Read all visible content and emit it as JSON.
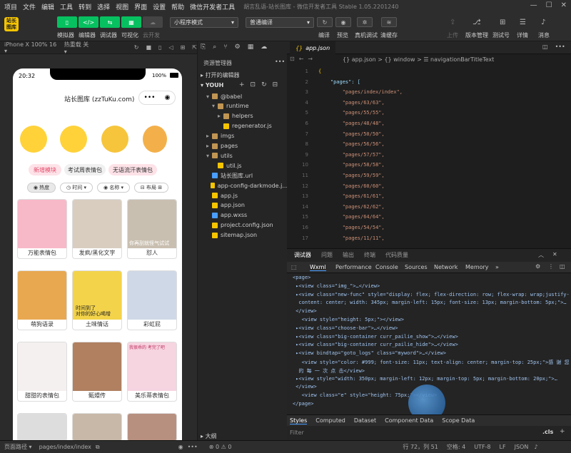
{
  "menubar": {
    "items": [
      "项目",
      "文件",
      "编辑",
      "工具",
      "转到",
      "选择",
      "视图",
      "界面",
      "设置",
      "帮助",
      "微信开发者工具"
    ],
    "title": "胡言乱语-站长图库 - 微信开发者工具 Stable 1.05.2201240"
  },
  "toolbar": {
    "logo": "站长图库",
    "simulator": "模拟器",
    "editor": "编辑器",
    "debugger": "调试器",
    "visual": "可视化",
    "cloud": "云开发",
    "mode_select": "小程序模式",
    "compile_select": "普通编译",
    "compile": "编译",
    "preview": "预览",
    "real_debug": "真机调试",
    "clear_cache": "清缓存",
    "upload": "上传",
    "version": "版本管理",
    "test": "测试号",
    "detail": "详情",
    "msg": "消息"
  },
  "simbar": {
    "device": "iPhone X 100% 16 ▾",
    "hot": "热重载 关 ▾"
  },
  "phone": {
    "time": "20:32",
    "battery": "100%",
    "title": "站长图库 (zzTuKu.com)",
    "tags": [
      "新增模块",
      "考试周表情包",
      "无语流汗表情包"
    ],
    "chips": [
      "热度",
      "时间",
      "名称",
      "布局"
    ],
    "cards": [
      {
        "cap": "万能表情包",
        "color": "#f7b8c8"
      },
      {
        "cap": "发疯/黑化文字",
        "color": "#d8cdbf"
      },
      {
        "cap": "怼人",
        "color": "#c9bfb0"
      },
      {
        "cap": "萌狗语录",
        "color": "#e8a850"
      },
      {
        "cap": "土味情话",
        "color": "#f3d34a"
      },
      {
        "cap": "彩虹屁",
        "color": "#cfd8e6"
      },
      {
        "cap": "甜甜的表情包",
        "color": "#f5f0f0"
      },
      {
        "cap": "甄嬛传",
        "color": "#b08060"
      },
      {
        "cap": "美乐蒂表情包",
        "color": "#f6d4e0"
      }
    ],
    "card_texts": [
      "你再刮就怪气试试",
      "时间到了\n对你的好心喝增",
      "我很乖的 考完了吧"
    ]
  },
  "explorer": {
    "title": "资源管理器",
    "open_editors": "打开的编辑器",
    "project": "YOUH",
    "files": [
      {
        "name": "@babel",
        "indent": 1,
        "type": "folder",
        "arrow": "▾"
      },
      {
        "name": "runtime",
        "indent": 2,
        "type": "folder",
        "arrow": "▾"
      },
      {
        "name": "helpers",
        "indent": 3,
        "type": "folder",
        "arrow": "▸"
      },
      {
        "name": "regenerator.js",
        "indent": 3,
        "type": "js",
        "arrow": ""
      },
      {
        "name": "imgs",
        "indent": 1,
        "type": "folder",
        "arrow": "▸"
      },
      {
        "name": "pages",
        "indent": 1,
        "type": "folder",
        "arrow": "▸"
      },
      {
        "name": "utils",
        "indent": 1,
        "type": "folder",
        "arrow": "▾"
      },
      {
        "name": "util.js",
        "indent": 2,
        "type": "js",
        "arrow": ""
      },
      {
        "name": "站长图库.url",
        "indent": 1,
        "type": "url",
        "arrow": ""
      },
      {
        "name": "app-config-darkmode.j...",
        "indent": 1,
        "type": "json",
        "arrow": ""
      },
      {
        "name": "app.js",
        "indent": 1,
        "type": "js",
        "arrow": ""
      },
      {
        "name": "app.json",
        "indent": 1,
        "type": "json",
        "arrow": ""
      },
      {
        "name": "app.wxss",
        "indent": 1,
        "type": "wxss",
        "arrow": ""
      },
      {
        "name": "project.config.json",
        "indent": 1,
        "type": "json",
        "arrow": ""
      },
      {
        "name": "sitemap.json",
        "indent": 1,
        "type": "json",
        "arrow": ""
      }
    ],
    "outline": "大纲"
  },
  "editor": {
    "tab": "app.json",
    "breadcrumb": "{} app.json > {} window > ☰ navigationBarTitleText",
    "lines": [
      "{",
      "    \"pages\": [",
      "        \"pages/index/index\",",
      "        \"pages/63/63\",",
      "        \"pages/55/55\",",
      "        \"pages/48/48\",",
      "        \"pages/50/50\",",
      "        \"pages/56/56\",",
      "        \"pages/57/57\",",
      "        \"pages/58/58\",",
      "        \"pages/59/59\",",
      "        \"pages/60/60\",",
      "        \"pages/61/61\",",
      "        \"pages/62/62\",",
      "        \"pages/64/64\",",
      "        \"pages/54/54\",",
      "        \"pages/11/11\","
    ]
  },
  "devtools": {
    "top_tabs": [
      "调试器",
      "问题",
      "输出",
      "终端",
      "代码质量"
    ],
    "tabs": [
      "Wxml",
      "Performance",
      "Console",
      "Sources",
      "Network",
      "Memory",
      "»"
    ],
    "lines": [
      "<page>",
      " ▸<view class=\"img_\">…</view>",
      " ▸<view class=\"new-func\" style=\"display: flex; flex-direction: row; flex-wrap: wrap;justify-",
      "  content: center; width: 345px; margin-left: 15px; font-size: 13px; margin-bottom: 5px;\">…",
      " </view>",
      "   <view style=\"height: 5px;\"></view>",
      " ▸<view class=\"choose-bar\">…</view>",
      " ▸<view class=\"big-container curr_pailie_show\">…</view>",
      " ▸<view class=\"big-container curr_pailie_hide\">…</view>",
      " ▸<view bindtap=\"goto_logs\" class=\"myword\">…</view>",
      "   <view style=\"color: #999; font-size: 11px; text-align: center; margin-top: 25px;\">感 谢 您",
      "  的 每 一 次 点 击</view>",
      " ▸<view style=\"width: 350px; margin-left: 12px; margin-top: 5px; margin-bottom: 20px;\">…",
      " </view>",
      "   <view class=\"e\" style=\"height: 75px;\"></view>",
      "</page>"
    ],
    "bottom_tabs": [
      "Styles",
      "Computed",
      "Dataset",
      "Component Data",
      "Scope Data"
    ],
    "filter": "Filter",
    "cls": ".cls"
  },
  "status": {
    "path_label": "页面路径 ▾",
    "path": "pages/index/index",
    "errors": "⊗ 0 ⚠ 0",
    "pos": "行 72，列 51",
    "spaces": "空格: 4",
    "enc": "UTF-8",
    "eol": "LF",
    "lang": "JSON"
  }
}
